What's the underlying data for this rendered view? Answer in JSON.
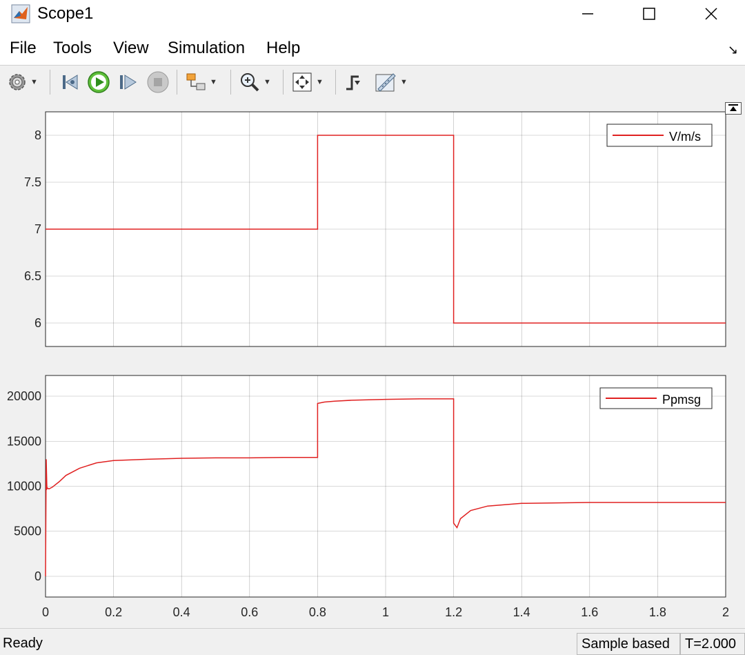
{
  "window": {
    "title": "Scope1"
  },
  "menu": {
    "file": "File",
    "tools": "Tools",
    "view": "View",
    "simulation": "Simulation",
    "help": "Help"
  },
  "toolbar": {
    "icons": [
      "gear-icon",
      "step-back-icon",
      "run-icon",
      "step-forward-icon",
      "stop-icon",
      "highlight-icon",
      "zoom-icon",
      "autoscale-icon",
      "triggers-icon",
      "measurements-icon"
    ]
  },
  "status": {
    "ready": "Ready",
    "sample_mode": "Sample based",
    "time": "T=2.000"
  },
  "colors": {
    "signal": "#e02020",
    "plot_bg": "#ffffff",
    "grid": "#262626",
    "chrome": "#f0f0f0"
  },
  "chart_data": [
    {
      "type": "line",
      "xlim": [
        0,
        2
      ],
      "ylim": [
        5.75,
        8.25
      ],
      "xticks": [
        0,
        0.2,
        0.4,
        0.6,
        0.8,
        1,
        1.2,
        1.4,
        1.6,
        1.8,
        2
      ],
      "yticks": [
        "6",
        "6.5",
        "7",
        "7.5",
        "8"
      ],
      "grid": true,
      "legend_position": "top-right",
      "series": [
        {
          "name": "V/m/s",
          "x": [
            0,
            0.8,
            0.8,
            1.2,
            1.2,
            2.0
          ],
          "y": [
            7,
            7,
            8,
            8,
            6,
            6
          ]
        }
      ]
    },
    {
      "type": "line",
      "xlim": [
        0,
        2
      ],
      "ylim": [
        -2300,
        22300
      ],
      "xticks": [
        0,
        0.2,
        0.4,
        0.6,
        0.8,
        1,
        1.2,
        1.4,
        1.6,
        1.8,
        2
      ],
      "xticklabels": [
        "0",
        "0.2",
        "0.4",
        "0.6",
        "0.8",
        "1",
        "1.2",
        "1.4",
        "1.6",
        "1.8",
        "2"
      ],
      "yticks": [
        "0",
        "5000",
        "10000",
        "15000",
        "20000"
      ],
      "grid": true,
      "legend_position": "top-right",
      "series": [
        {
          "name": "Ppmsg",
          "x": [
            0,
            0.002,
            0.004,
            0.006,
            0.01,
            0.02,
            0.04,
            0.06,
            0.1,
            0.15,
            0.2,
            0.3,
            0.4,
            0.5,
            0.6,
            0.7,
            0.8,
            0.8,
            0.82,
            0.85,
            0.9,
            1.0,
            1.1,
            1.2,
            1.2,
            1.21,
            1.22,
            1.25,
            1.3,
            1.4,
            1.6,
            1.8,
            2.0
          ],
          "y": [
            0,
            13000,
            9700,
            9800,
            9700,
            9900,
            10500,
            11200,
            12000,
            12600,
            12850,
            13000,
            13100,
            13150,
            13150,
            13200,
            13200,
            19200,
            19350,
            19450,
            19550,
            19650,
            19700,
            19700,
            5900,
            5400,
            6400,
            7300,
            7800,
            8100,
            8200,
            8200,
            8200
          ]
        }
      ]
    }
  ]
}
